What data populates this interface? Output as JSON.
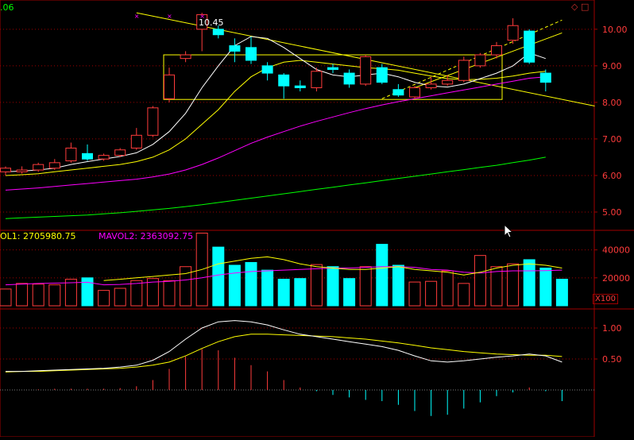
{
  "header": {
    "corner_value": ".06"
  },
  "annotations": {
    "peak_price": "10.45"
  },
  "volume": {
    "mavol1_label": "OL1: 2705980.75",
    "mavol2_label": "MAVOL2: 2363092.75",
    "unit_label": "X100"
  },
  "corner_icons": {
    "diamond": "◇",
    "square": "□"
  },
  "colors": {
    "up": "#ff3b3b",
    "down": "#00ffff",
    "ma5": "#ffffff",
    "ma10": "#ffff00",
    "ma20": "#ff00ff",
    "ma60": "#00ff00",
    "axis": "#a00000",
    "grid": "#a00000",
    "tick_text": "#ff3b3b",
    "trendline": "#ffff00"
  },
  "chart_data": [
    {
      "type": "candlestick",
      "ylim": [
        4.5,
        10.8
      ],
      "y_ticks": [
        "10.00",
        "9.00",
        "8.00",
        "7.00",
        "6.00",
        "5.00"
      ],
      "candles": [
        {
          "o": 6.1,
          "h": 6.25,
          "l": 6.0,
          "c": 6.2
        },
        {
          "o": 6.1,
          "h": 6.25,
          "l": 6.05,
          "c": 6.15
        },
        {
          "o": 6.15,
          "h": 6.35,
          "l": 6.1,
          "c": 6.3
        },
        {
          "o": 6.2,
          "h": 6.45,
          "l": 6.15,
          "c": 6.35
        },
        {
          "o": 6.4,
          "h": 6.9,
          "l": 6.35,
          "c": 6.75
        },
        {
          "o": 6.6,
          "h": 6.85,
          "l": 6.4,
          "c": 6.45
        },
        {
          "o": 6.45,
          "h": 6.6,
          "l": 6.4,
          "c": 6.55
        },
        {
          "o": 6.55,
          "h": 6.75,
          "l": 6.5,
          "c": 6.7
        },
        {
          "o": 6.75,
          "h": 7.3,
          "l": 6.7,
          "c": 7.1
        },
        {
          "o": 7.1,
          "h": 7.9,
          "l": 7.05,
          "c": 7.85
        },
        {
          "o": 8.1,
          "h": 8.95,
          "l": 8.0,
          "c": 8.75
        },
        {
          "o": 9.2,
          "h": 9.4,
          "l": 9.1,
          "c": 9.3
        },
        {
          "o": 10.0,
          "h": 10.45,
          "l": 9.4,
          "c": 10.4
        },
        {
          "o": 10.0,
          "h": 10.1,
          "l": 9.75,
          "c": 9.85
        },
        {
          "o": 9.55,
          "h": 9.75,
          "l": 9.1,
          "c": 9.4
        },
        {
          "o": 9.5,
          "h": 9.8,
          "l": 9.05,
          "c": 9.15
        },
        {
          "o": 9.0,
          "h": 9.1,
          "l": 8.6,
          "c": 8.8
        },
        {
          "o": 8.75,
          "h": 8.8,
          "l": 8.1,
          "c": 8.45
        },
        {
          "o": 8.45,
          "h": 8.6,
          "l": 8.3,
          "c": 8.4
        },
        {
          "o": 8.4,
          "h": 8.95,
          "l": 8.3,
          "c": 8.85
        },
        {
          "o": 8.95,
          "h": 9.05,
          "l": 8.8,
          "c": 8.9
        },
        {
          "o": 8.8,
          "h": 8.9,
          "l": 8.4,
          "c": 8.5
        },
        {
          "o": 8.5,
          "h": 9.3,
          "l": 8.45,
          "c": 9.25
        },
        {
          "o": 8.95,
          "h": 9.05,
          "l": 8.5,
          "c": 8.55
        },
        {
          "o": 8.35,
          "h": 8.5,
          "l": 8.15,
          "c": 8.2
        },
        {
          "o": 8.15,
          "h": 8.45,
          "l": 8.1,
          "c": 8.4
        },
        {
          "o": 8.4,
          "h": 8.7,
          "l": 8.35,
          "c": 8.5
        },
        {
          "o": 8.5,
          "h": 8.75,
          "l": 8.45,
          "c": 8.6
        },
        {
          "o": 8.6,
          "h": 9.25,
          "l": 8.55,
          "c": 9.15
        },
        {
          "o": 9.0,
          "h": 9.35,
          "l": 8.95,
          "c": 9.3
        },
        {
          "o": 9.3,
          "h": 9.65,
          "l": 9.2,
          "c": 9.55
        },
        {
          "o": 9.7,
          "h": 10.3,
          "l": 9.6,
          "c": 10.1
        },
        {
          "o": 9.95,
          "h": 10.0,
          "l": 9.05,
          "c": 9.1
        },
        {
          "o": 8.8,
          "h": 8.9,
          "l": 8.3,
          "c": 8.55
        }
      ],
      "ma5": [
        6.1,
        6.12,
        6.15,
        6.2,
        6.3,
        6.38,
        6.45,
        6.52,
        6.62,
        6.85,
        7.2,
        7.7,
        8.4,
        9.0,
        9.55,
        9.8,
        9.75,
        9.5,
        9.2,
        8.9,
        8.75,
        8.7,
        8.75,
        8.8,
        8.7,
        8.55,
        8.45,
        8.42,
        8.5,
        8.65,
        8.8,
        9.0,
        9.35,
        9.2
      ],
      "ma10": [
        6.0,
        6.02,
        6.05,
        6.1,
        6.15,
        6.2,
        6.25,
        6.3,
        6.38,
        6.5,
        6.7,
        7.0,
        7.4,
        7.8,
        8.3,
        8.7,
        8.95,
        9.1,
        9.15,
        9.1,
        9.05,
        9.0,
        8.95,
        8.92,
        8.88,
        8.8,
        8.72,
        8.65,
        8.62,
        8.63,
        8.66,
        8.72,
        8.8,
        8.85
      ],
      "ma20": [
        5.6,
        5.63,
        5.66,
        5.7,
        5.74,
        5.78,
        5.82,
        5.86,
        5.9,
        5.96,
        6.04,
        6.15,
        6.3,
        6.48,
        6.68,
        6.88,
        7.05,
        7.2,
        7.35,
        7.48,
        7.6,
        7.72,
        7.83,
        7.93,
        8.02,
        8.1,
        8.18,
        8.26,
        8.34,
        8.42,
        8.5,
        8.58,
        8.66,
        8.7
      ],
      "ma60": [
        4.82,
        4.84,
        4.86,
        4.88,
        4.9,
        4.92,
        4.95,
        4.98,
        5.02,
        5.06,
        5.1,
        5.15,
        5.2,
        5.26,
        5.32,
        5.38,
        5.44,
        5.5,
        5.56,
        5.62,
        5.68,
        5.74,
        5.8,
        5.86,
        5.92,
        5.98,
        6.04,
        6.1,
        6.16,
        6.22,
        6.28,
        6.35,
        6.42,
        6.5
      ],
      "consolidation_box": {
        "from_index": 10,
        "to_index": 30,
        "high": 9.3,
        "low": 8.08
      },
      "trendlines": [
        {
          "from": [
            8,
            10.45
          ],
          "to": [
            36,
            7.9
          ]
        },
        {
          "from": [
            23,
            8.1
          ],
          "to": [
            34,
            10.25
          ],
          "dashed": true
        },
        {
          "from": [
            25,
            8.4
          ],
          "to": [
            34,
            9.9
          ],
          "dashed": false
        }
      ]
    },
    {
      "type": "bar",
      "ylim": [
        0,
        54000
      ],
      "y_ticks": [
        "40000",
        "20000"
      ],
      "values": [
        12000,
        16000,
        15500,
        15000,
        19000,
        20000,
        11000,
        12500,
        18000,
        19500,
        18000,
        28000,
        52000,
        42000,
        29000,
        31000,
        25500,
        19000,
        19500,
        29500,
        28000,
        19500,
        28000,
        44000,
        29000,
        17000,
        17500,
        25000,
        16000,
        36000,
        28000,
        30000,
        33000,
        27000,
        19000
      ],
      "mavol1": [
        null,
        null,
        null,
        null,
        null,
        null,
        18000,
        19000,
        20000,
        21000,
        22000,
        23000,
        26000,
        30000,
        32000,
        34000,
        35000,
        33000,
        30000,
        28000,
        27000,
        26000,
        26000,
        27000,
        28000,
        26000,
        25000,
        24000,
        22000,
        24000,
        27000,
        29000,
        30000,
        29000,
        27000
      ],
      "mavol2": [
        15000,
        15500,
        16000,
        16200,
        16500,
        16800,
        15000,
        15300,
        16000,
        17000,
        17500,
        18500,
        20000,
        22000,
        23500,
        24500,
        25000,
        25500,
        26000,
        26500,
        27000,
        27000,
        27500,
        28000,
        28000,
        27500,
        26000,
        25500,
        24000,
        23500,
        24500,
        25000,
        25000,
        25200,
        25500
      ],
      "shown_from_index": 0
    },
    {
      "type": "macd",
      "ylim": [
        -0.75,
        1.4
      ],
      "y_ticks": [
        "1.00",
        "0.50"
      ],
      "dif": [
        0.3,
        0.3,
        0.31,
        0.32,
        0.33,
        0.34,
        0.35,
        0.37,
        0.4,
        0.48,
        0.62,
        0.82,
        1.0,
        1.1,
        1.12,
        1.1,
        1.05,
        0.97,
        0.9,
        0.86,
        0.82,
        0.78,
        0.74,
        0.7,
        0.64,
        0.55,
        0.47,
        0.45,
        0.47,
        0.5,
        0.53,
        0.55,
        0.58,
        0.55,
        0.45
      ],
      "dea": [
        0.29,
        0.3,
        0.3,
        0.31,
        0.32,
        0.33,
        0.34,
        0.35,
        0.37,
        0.4,
        0.45,
        0.55,
        0.67,
        0.78,
        0.86,
        0.9,
        0.9,
        0.89,
        0.88,
        0.87,
        0.86,
        0.84,
        0.82,
        0.79,
        0.76,
        0.72,
        0.68,
        0.65,
        0.62,
        0.6,
        0.58,
        0.57,
        0.56,
        0.56,
        0.54
      ],
      "macd": [
        0.0,
        0.0,
        0.01,
        0.02,
        0.02,
        0.02,
        0.02,
        0.03,
        0.06,
        0.16,
        0.34,
        0.54,
        0.66,
        0.64,
        0.52,
        0.4,
        0.3,
        0.16,
        0.04,
        -0.02,
        -0.08,
        -0.12,
        -0.16,
        -0.18,
        -0.24,
        -0.34,
        -0.42,
        -0.4,
        -0.3,
        -0.2,
        -0.1,
        -0.04,
        0.04,
        -0.02,
        -0.18
      ]
    }
  ]
}
